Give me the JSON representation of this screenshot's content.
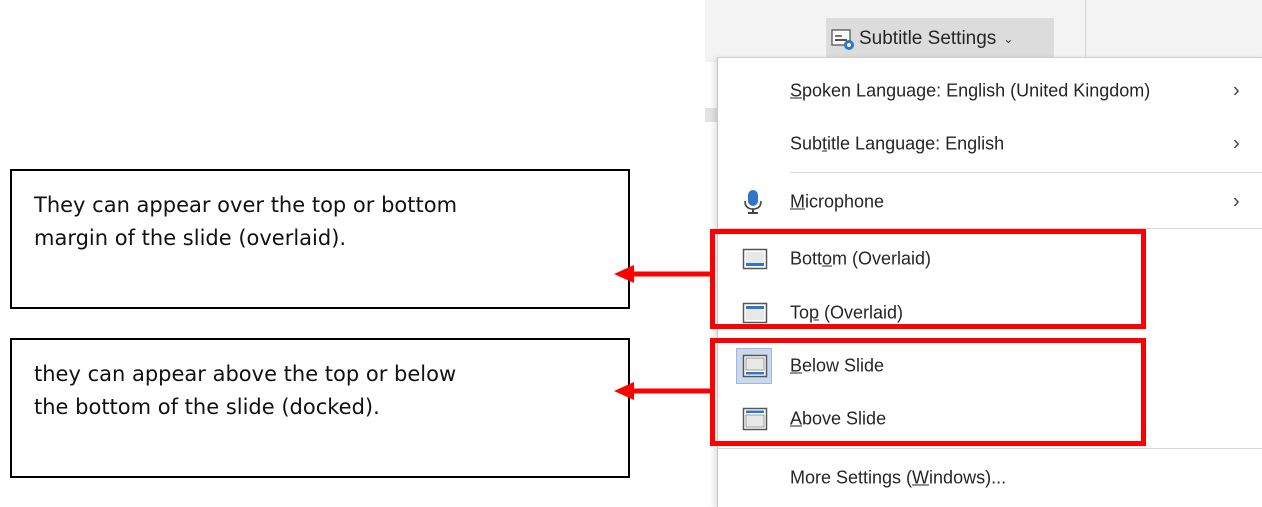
{
  "ribbon": {
    "subtitle_settings_label": "Subtitle Settings",
    "subtitle_settings_icon": "subtitle-settings-icon",
    "chevron": "⌄"
  },
  "menu": {
    "spoken_language": {
      "pre": "",
      "u": "S",
      "post": "poken Language: English (United Kingdom)"
    },
    "subtitle_language": {
      "pre": "Sub",
      "u": "t",
      "post": "itle Language: English"
    },
    "microphone": {
      "pre": "",
      "u": "M",
      "post": "icrophone"
    },
    "bottom_overlaid": {
      "pre": "Bott",
      "u": "o",
      "post": "m (Overlaid)"
    },
    "top_overlaid": {
      "pre": "To",
      "u": "p",
      "post": " (Overlaid)"
    },
    "below_slide": {
      "pre": "",
      "u": "B",
      "post": "elow Slide"
    },
    "above_slide": {
      "pre": "",
      "u": "A",
      "post": "bove Slide"
    },
    "more_settings": {
      "pre": "More Settings (",
      "u": "W",
      "post": "indows)..."
    },
    "submenu_arrow": "›"
  },
  "annotations": {
    "overlaid_text_line1": "They can appear over the top or bottom",
    "overlaid_text_line2": "margin of the slide (overlaid).",
    "docked_text_line1": "they can appear above the top or below",
    "docked_text_line2": "the bottom of the slide (docked).",
    "highlight_color": "#ff0000"
  }
}
